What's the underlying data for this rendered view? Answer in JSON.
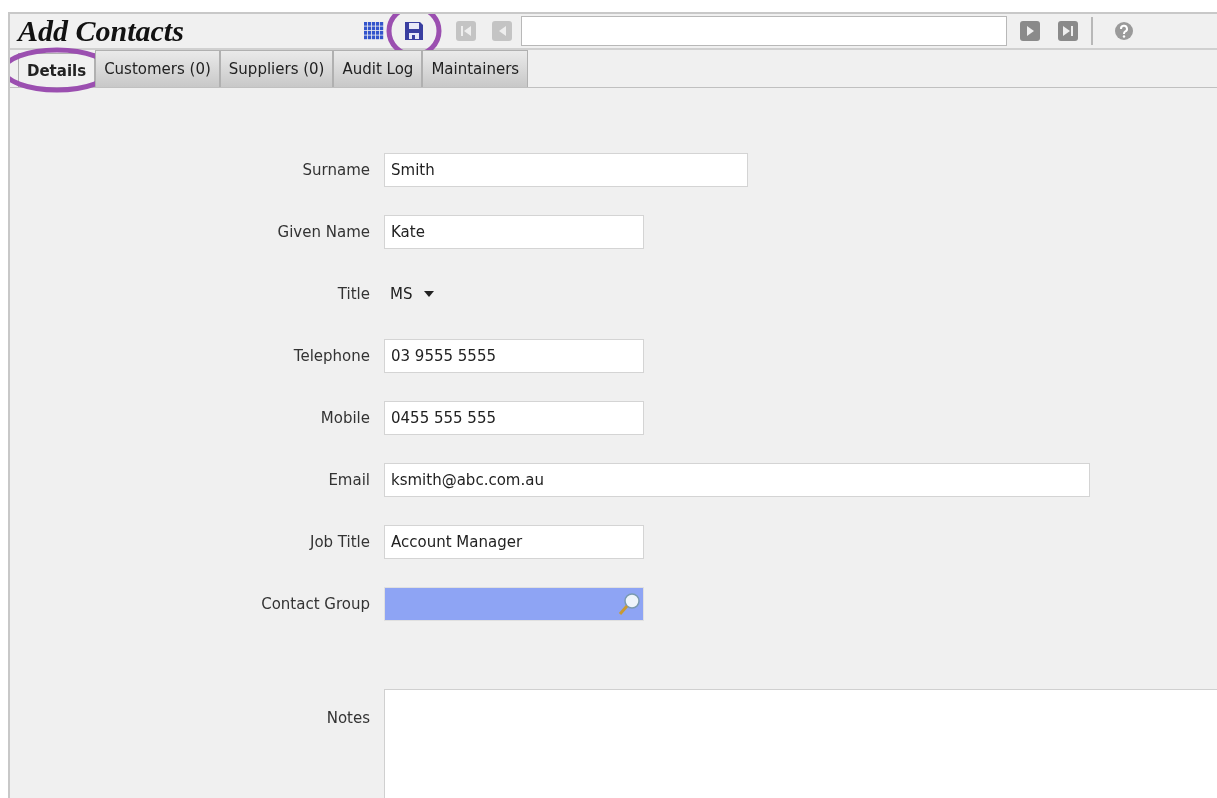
{
  "window": {
    "title": "Add Contacts"
  },
  "toolbar": [
    {
      "kind": "grid",
      "circled": false
    },
    {
      "kind": "save",
      "circled": true
    },
    {
      "kind": "first",
      "circled": false
    },
    {
      "kind": "prev",
      "circled": false
    },
    {
      "kind": "search",
      "circled": false
    },
    {
      "kind": "next",
      "circled": false
    },
    {
      "kind": "last",
      "circled": false
    },
    {
      "kind": "divider",
      "circled": false
    },
    {
      "kind": "help",
      "circled": false
    }
  ],
  "tabs": [
    {
      "label": "Details",
      "selected": true,
      "highlighted": true
    },
    {
      "label": "Customers (0)",
      "selected": false,
      "highlighted": false
    },
    {
      "label": "Suppliers (0)",
      "selected": false,
      "highlighted": false
    },
    {
      "label": "Audit Log",
      "selected": false,
      "highlighted": false
    },
    {
      "label": "Maintainers",
      "selected": false,
      "highlighted": false
    }
  ],
  "fields": [
    {
      "label": "Surname",
      "kind": "text",
      "value": "Smith"
    },
    {
      "label": "Given Name",
      "kind": "text",
      "value": "Kate"
    },
    {
      "label": "Title",
      "kind": "select",
      "value": "MS"
    },
    {
      "label": "Telephone",
      "kind": "text",
      "value": "03 9555 5555"
    },
    {
      "label": "Mobile",
      "kind": "text",
      "value": "0455 555 555"
    },
    {
      "label": "Email",
      "kind": "text",
      "value": "ksmith@abc.com.au"
    },
    {
      "label": "Job Title",
      "kind": "text",
      "value": "Account Manager"
    },
    {
      "label": "Contact Group",
      "kind": "lookup"
    },
    {
      "label": "Notes",
      "kind": "textarea"
    }
  ]
}
